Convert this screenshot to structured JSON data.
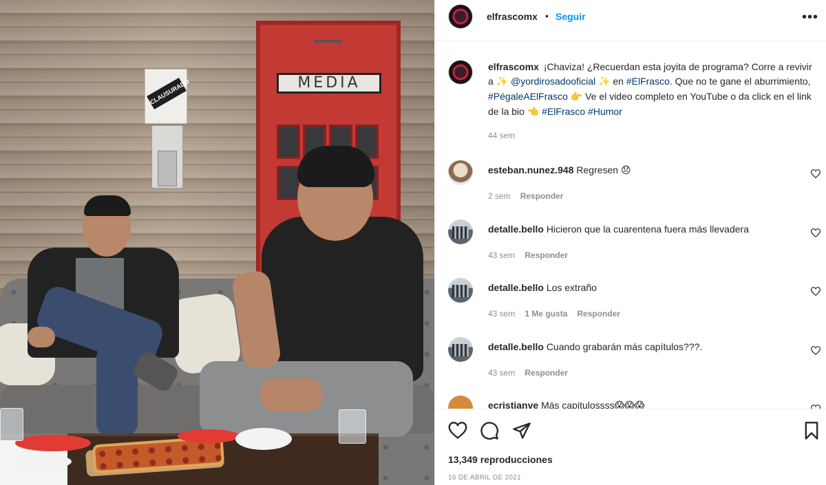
{
  "post": {
    "username": "elfrascomx",
    "follow_label": "Seguir",
    "more_label": "•••"
  },
  "caption": {
    "username": "elfrascomx",
    "part1": "¡Chaviza! ¿Recuerdan esta joyita de programa? Corre a revivir a ",
    "emoji1": "✨",
    "mention": "@yordirosadooficial",
    "emoji2": "✨",
    "part2": " en ",
    "hashtag1": "#ElFrasco",
    "part3": ". Que no te gane el aburrimiento, ",
    "hashtag2": "#PégaleAElFrasco",
    "emoji3": "👉",
    "part4": " Ve el video completo en YouTube o da click en el link de la bio ",
    "emoji4": "👈",
    "hashtag3": "#ElFrasco",
    "hashtag4": "#Humor",
    "time": "44 sem"
  },
  "comments": [
    {
      "username": "esteban.nunez.948",
      "text": "Regresen",
      "emoji": "😞",
      "time": "2 sem",
      "likes": "",
      "reply": "Responder",
      "avatar": "dog-avatar"
    },
    {
      "username": "detalle.bello",
      "text": "Hicieron que la cuarentena fuera más llevadera",
      "emoji": "",
      "time": "43 sem",
      "likes": "",
      "reply": "Responder",
      "avatar": "city-avatar"
    },
    {
      "username": "detalle.bello",
      "text": "Los extraño",
      "emoji": "",
      "time": "43 sem",
      "likes": "1 Me gusta",
      "reply": "Responder",
      "avatar": "city-avatar"
    },
    {
      "username": "detalle.bello",
      "text": "Cuando grabarán más capítulos???.",
      "emoji": "",
      "time": "43 sem",
      "likes": "",
      "reply": "Responder",
      "avatar": "city-avatar"
    },
    {
      "username": "ecristianve",
      "text": "Más capitulossss",
      "emoji": "😱😱😱",
      "time": "",
      "likes": "",
      "reply": "",
      "avatar": "red-avatar"
    }
  ],
  "actions": {
    "views": "13,349 reproducciones",
    "date": "16 DE ABRIL DE 2021"
  },
  "video": {
    "door_sign": "MEDIA",
    "wall_sign": "CLAUSURADO"
  }
}
